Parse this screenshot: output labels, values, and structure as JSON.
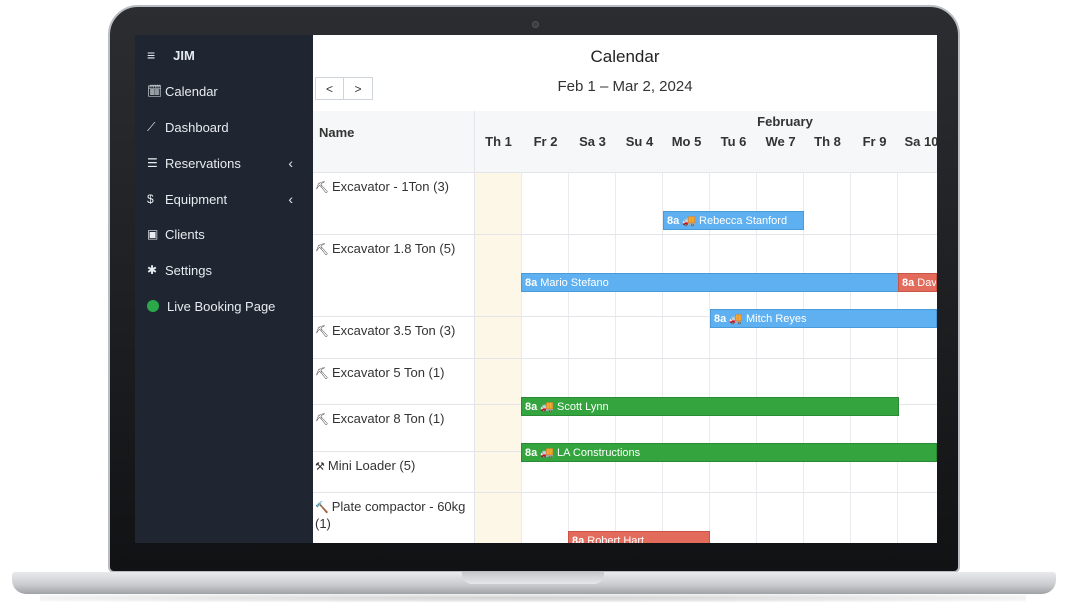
{
  "app": {
    "brand": "JIM",
    "menu_icon": "hamburger-icon"
  },
  "sidebar": {
    "items": [
      {
        "label": "Calendar",
        "icon": "calendar-icon",
        "glyph": "🗓"
      },
      {
        "label": "Dashboard",
        "icon": "chart-line-icon",
        "glyph": "⟋"
      },
      {
        "label": "Reservations",
        "icon": "list-check-icon",
        "glyph": "☰"
      },
      {
        "label": "Equipment",
        "icon": "dollar-icon",
        "glyph": "$"
      },
      {
        "label": "Clients",
        "icon": "id-card-icon",
        "glyph": "▣"
      },
      {
        "label": "Settings",
        "icon": "gear-icon",
        "glyph": "✱"
      },
      {
        "label": "Live Booking Page",
        "icon": "status-dot-icon"
      }
    ],
    "chevron": "‹"
  },
  "calendar": {
    "title": "Calendar",
    "range": "Feb 1 – Mar 2, 2024",
    "prev": "<",
    "next": ">",
    "name_header": "Name",
    "month": "February",
    "days": [
      "Th 1",
      "Fr 2",
      "Sa 3",
      "Su 4",
      "Mo 5",
      "Tu 6",
      "We 7",
      "Th 8",
      "Fr 9",
      "Sa 10"
    ],
    "resources": [
      {
        "name": "Excavator - 1Ton (3)"
      },
      {
        "name": "Excavator 1.8 Ton (5)"
      },
      {
        "name": "Excavator 3.5 Ton (3)"
      },
      {
        "name": "Excavator 5 Ton (1)"
      },
      {
        "name": "Excavator 8 Ton (1)"
      },
      {
        "name": "Mini Loader (5)"
      },
      {
        "name": "Plate compactor - 60kg (1)"
      }
    ],
    "events": [
      {
        "time": "8a",
        "delivery": true,
        "label": "Rebecca Stanford",
        "color": "#5fb0f0"
      },
      {
        "time": "8a",
        "delivery": false,
        "label": "Mario Stefano",
        "color": "#5fb0f0"
      },
      {
        "time": "8a",
        "delivery": false,
        "label": "Dav",
        "color": "#e36b5c"
      },
      {
        "time": "8a",
        "delivery": true,
        "label": "Mitch Reyes",
        "color": "#5fb0f0"
      },
      {
        "time": "8a",
        "delivery": true,
        "label": "Scott Lynn",
        "color": "#34a53e"
      },
      {
        "time": "8a",
        "delivery": true,
        "label": "LA Constructions",
        "color": "#34a53e"
      },
      {
        "time": "8a",
        "delivery": false,
        "label": "Robert Hart",
        "color": "#e36b5c"
      }
    ],
    "delivery_glyph": "🚚"
  }
}
